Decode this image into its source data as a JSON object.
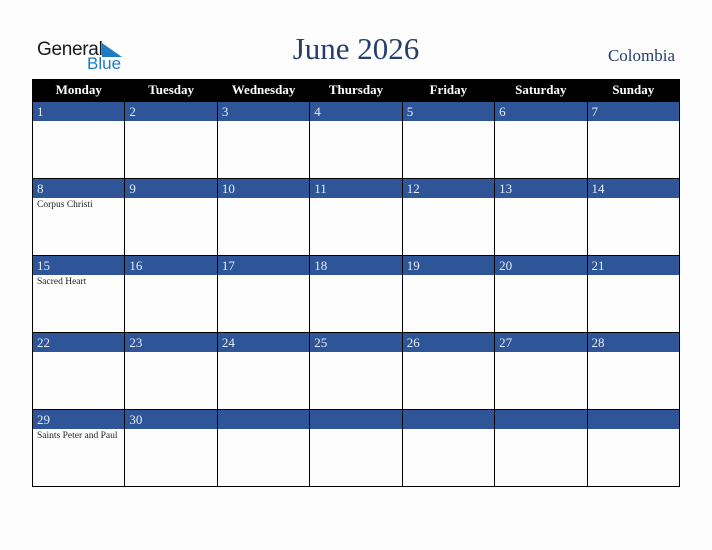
{
  "logo": {
    "line1": "General",
    "line2": "Blue",
    "icon": "triangle-flag-icon"
  },
  "header": {
    "title": "June 2026",
    "country": "Colombia"
  },
  "colors": {
    "day_bar": "#2E5597",
    "title_text": "#253E6A",
    "logo_blue": "#1E7BC6"
  },
  "weekdays": [
    "Monday",
    "Tuesday",
    "Wednesday",
    "Thursday",
    "Friday",
    "Saturday",
    "Sunday"
  ],
  "weeks": [
    [
      {
        "day": "1",
        "holiday": ""
      },
      {
        "day": "2",
        "holiday": ""
      },
      {
        "day": "3",
        "holiday": ""
      },
      {
        "day": "4",
        "holiday": ""
      },
      {
        "day": "5",
        "holiday": ""
      },
      {
        "day": "6",
        "holiday": ""
      },
      {
        "day": "7",
        "holiday": ""
      }
    ],
    [
      {
        "day": "8",
        "holiday": "Corpus Christi"
      },
      {
        "day": "9",
        "holiday": ""
      },
      {
        "day": "10",
        "holiday": ""
      },
      {
        "day": "11",
        "holiday": ""
      },
      {
        "day": "12",
        "holiday": ""
      },
      {
        "day": "13",
        "holiday": ""
      },
      {
        "day": "14",
        "holiday": ""
      }
    ],
    [
      {
        "day": "15",
        "holiday": "Sacred Heart"
      },
      {
        "day": "16",
        "holiday": ""
      },
      {
        "day": "17",
        "holiday": ""
      },
      {
        "day": "18",
        "holiday": ""
      },
      {
        "day": "19",
        "holiday": ""
      },
      {
        "day": "20",
        "holiday": ""
      },
      {
        "day": "21",
        "holiday": ""
      }
    ],
    [
      {
        "day": "22",
        "holiday": ""
      },
      {
        "day": "23",
        "holiday": ""
      },
      {
        "day": "24",
        "holiday": ""
      },
      {
        "day": "25",
        "holiday": ""
      },
      {
        "day": "26",
        "holiday": ""
      },
      {
        "day": "27",
        "holiday": ""
      },
      {
        "day": "28",
        "holiday": ""
      }
    ],
    [
      {
        "day": "29",
        "holiday": "Saints Peter and Paul"
      },
      {
        "day": "30",
        "holiday": ""
      },
      {
        "day": "",
        "holiday": ""
      },
      {
        "day": "",
        "holiday": ""
      },
      {
        "day": "",
        "holiday": ""
      },
      {
        "day": "",
        "holiday": ""
      },
      {
        "day": "",
        "holiday": ""
      }
    ]
  ]
}
